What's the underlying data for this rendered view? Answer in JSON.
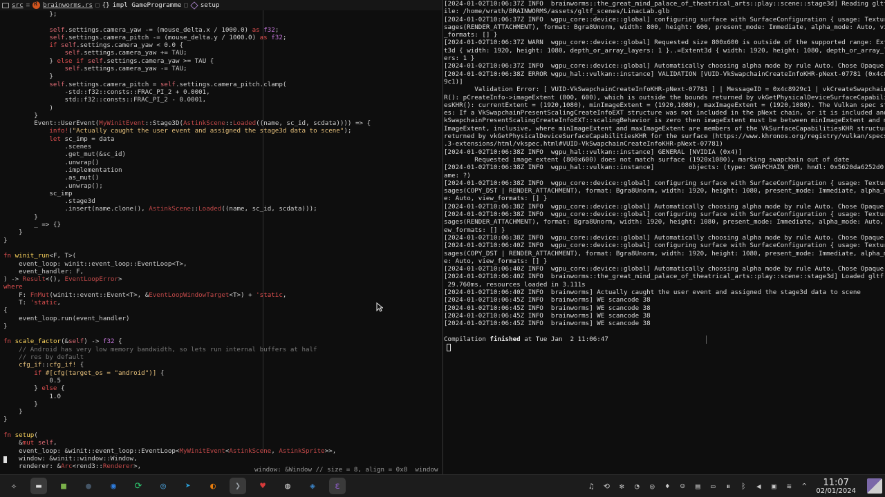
{
  "breadcrumb": {
    "folder": "src",
    "file": "brainworms.rs",
    "impl": "impl GameProgramme",
    "method": "setup"
  },
  "editor": {
    "hint": "window: &Window // size = 8, align = 0x8  window",
    "lines": [
      [
        [
          "            };",
          ""
        ]
      ],
      [
        [
          "",
          ""
        ]
      ],
      [
        [
          "            ",
          ""
        ],
        [
          "self",
          "self"
        ],
        [
          ".settings.camera_yaw -= (mouse_delta.x / 1000.0) ",
          ""
        ],
        [
          "as",
          "k"
        ],
        [
          " ",
          ""
        ],
        [
          "f32",
          "t"
        ],
        [
          ";",
          ""
        ]
      ],
      [
        [
          "            ",
          ""
        ],
        [
          "self",
          "self"
        ],
        [
          ".settings.camera_pitch -= (mouse_delta.y / 1000.0) ",
          ""
        ],
        [
          "as",
          "k"
        ],
        [
          " ",
          ""
        ],
        [
          "f32",
          "t"
        ],
        [
          ";",
          ""
        ]
      ],
      [
        [
          "            ",
          ""
        ],
        [
          "if",
          "k"
        ],
        [
          " ",
          ""
        ],
        [
          "self",
          "self"
        ],
        [
          ".settings.camera_yaw < 0.0 {",
          ""
        ]
      ],
      [
        [
          "                ",
          ""
        ],
        [
          "self",
          "self"
        ],
        [
          ".settings.camera_yaw += TAU;",
          ""
        ]
      ],
      [
        [
          "            } ",
          ""
        ],
        [
          "else if",
          "k"
        ],
        [
          " ",
          ""
        ],
        [
          "self",
          "self"
        ],
        [
          ".settings.camera_yaw >= TAU {",
          ""
        ]
      ],
      [
        [
          "                ",
          ""
        ],
        [
          "self",
          "self"
        ],
        [
          ".settings.camera_yaw -= TAU;",
          ""
        ]
      ],
      [
        [
          "            }",
          ""
        ]
      ],
      [
        [
          "            ",
          ""
        ],
        [
          "self",
          "self"
        ],
        [
          ".settings.camera_pitch = ",
          ""
        ],
        [
          "self",
          "self"
        ],
        [
          ".settings.camera_pitch.clamp(",
          ""
        ]
      ],
      [
        [
          "                -std::f32::consts::FRAC_PI_2 + 0.0001,",
          ""
        ]
      ],
      [
        [
          "                std::f32::consts::FRAC_PI_2 - 0.0001,",
          ""
        ]
      ],
      [
        [
          "            )",
          ""
        ]
      ],
      [
        [
          "        }",
          ""
        ]
      ],
      [
        [
          "        Event::UserEvent(",
          ""
        ],
        [
          "MyWinitEvent",
          "g"
        ],
        [
          "::Stage3D(",
          ""
        ],
        [
          "AstinkScene",
          "g"
        ],
        [
          "::",
          ""
        ],
        [
          "Loaded",
          "g"
        ],
        [
          "((name, sc_id, scdata)))) => {",
          ""
        ]
      ],
      [
        [
          "            ",
          ""
        ],
        [
          "info!",
          "k"
        ],
        [
          "(",
          ""
        ],
        [
          "\"Actually caught the user event and assigned the stage3d data to scene\"",
          "s"
        ],
        [
          ");",
          ""
        ]
      ],
      [
        [
          "            ",
          ""
        ],
        [
          "let",
          "k"
        ],
        [
          " sc_imp = data",
          ""
        ]
      ],
      [
        [
          "                .scenes",
          ""
        ]
      ],
      [
        [
          "                .get_mut(&sc_id)",
          ""
        ]
      ],
      [
        [
          "                .unwrap()",
          ""
        ]
      ],
      [
        [
          "                .implementation",
          ""
        ]
      ],
      [
        [
          "                .as_mut()",
          ""
        ]
      ],
      [
        [
          "                .unwrap();",
          ""
        ]
      ],
      [
        [
          "            sc_imp",
          ""
        ]
      ],
      [
        [
          "                .stage3d",
          ""
        ]
      ],
      [
        [
          "                .insert(name.clone(), ",
          ""
        ],
        [
          "AstinkScene",
          "g"
        ],
        [
          "::",
          ""
        ],
        [
          "Loaded",
          "g"
        ],
        [
          "((name, sc_id, scdata)));",
          ""
        ]
      ],
      [
        [
          "        }",
          ""
        ]
      ],
      [
        [
          "        _ => {}",
          ""
        ]
      ],
      [
        [
          "    }",
          ""
        ]
      ],
      [
        [
          "}",
          ""
        ]
      ],
      [
        [
          "",
          ""
        ]
      ],
      [
        [
          "fn",
          "k"
        ],
        [
          " ",
          ""
        ],
        [
          "winit_run",
          "y"
        ],
        [
          "<F, T>(",
          ""
        ]
      ],
      [
        [
          "    event_loop: winit::event_loop::EventLoop<T>,",
          ""
        ]
      ],
      [
        [
          "    event_handler: F,",
          ""
        ]
      ],
      [
        [
          ") -> ",
          ""
        ],
        [
          "Result",
          "g"
        ],
        [
          "<(), ",
          ""
        ],
        [
          "EventLoopError",
          "g"
        ],
        [
          ">",
          ""
        ]
      ],
      [
        [
          "where",
          "k"
        ]
      ],
      [
        [
          "    F: ",
          ""
        ],
        [
          "FnMut",
          "g"
        ],
        [
          "(winit::event::Event<T>, &",
          ""
        ],
        [
          "EventLoopWindowTarget",
          "g"
        ],
        [
          "<T>) + ",
          ""
        ],
        [
          "'static",
          "k"
        ],
        [
          ",",
          ""
        ]
      ],
      [
        [
          "    T: ",
          ""
        ],
        [
          "'static",
          "k"
        ],
        [
          ",",
          ""
        ]
      ],
      [
        [
          "{",
          ""
        ]
      ],
      [
        [
          "    event_loop.run(event_handler)",
          ""
        ]
      ],
      [
        [
          "}",
          ""
        ]
      ],
      [
        [
          "",
          ""
        ]
      ],
      [
        [
          "fn",
          "k"
        ],
        [
          " ",
          ""
        ],
        [
          "scale_factor",
          "y"
        ],
        [
          "(&",
          ""
        ],
        [
          "self",
          "self"
        ],
        [
          ") -> ",
          ""
        ],
        [
          "f32",
          "t"
        ],
        [
          " {",
          ""
        ]
      ],
      [
        [
          "    // Android has very low memory bandwidth, so lets run internal buffers at half",
          "c"
        ]
      ],
      [
        [
          "    // res by default",
          "c"
        ]
      ],
      [
        [
          "    ",
          ""
        ],
        [
          "cfg_if",
          "s"
        ],
        [
          "::",
          ""
        ],
        [
          "cfg_if!",
          "s"
        ],
        [
          " {",
          ""
        ]
      ],
      [
        [
          "        ",
          ""
        ],
        [
          "if",
          "k"
        ],
        [
          " ",
          ""
        ],
        [
          "#[cfg(target_os = \"android\")]",
          "s"
        ],
        [
          " {",
          ""
        ]
      ],
      [
        [
          "            0.5",
          ""
        ]
      ],
      [
        [
          "        } ",
          ""
        ],
        [
          "else",
          "k"
        ],
        [
          " {",
          ""
        ]
      ],
      [
        [
          "            1.0",
          ""
        ]
      ],
      [
        [
          "        }",
          ""
        ]
      ],
      [
        [
          "    }",
          ""
        ]
      ],
      [
        [
          "}",
          ""
        ]
      ],
      [
        [
          "",
          ""
        ]
      ],
      [
        [
          "fn",
          "k"
        ],
        [
          " ",
          ""
        ],
        [
          "setup",
          "y"
        ],
        [
          "(",
          ""
        ]
      ],
      [
        [
          "    &",
          ""
        ],
        [
          "mut",
          "k"
        ],
        [
          " ",
          ""
        ],
        [
          "self",
          "self"
        ],
        [
          ",",
          ""
        ]
      ],
      [
        [
          "    event_loop: &winit::event_loop::EventLoop<",
          ""
        ],
        [
          "MyWinitEvent",
          "g"
        ],
        [
          "<",
          ""
        ],
        [
          "AstinkScene",
          "g"
        ],
        [
          ", ",
          ""
        ],
        [
          "AstinkSprite",
          "g"
        ],
        [
          ">>,",
          ""
        ]
      ],
      [
        [
          "    window: &winit::window::Window,",
          ""
        ]
      ],
      [
        [
          "    renderer: &",
          ""
        ],
        [
          "Arc",
          "g"
        ],
        [
          "<rend3::",
          ""
        ],
        [
          "Renderer",
          "g"
        ],
        [
          ">,",
          ""
        ]
      ]
    ]
  },
  "terminal": {
    "lines": [
      [
        [
          "[2024-01-02T10:06:37Z INFO  brainworms::the_great_mind_palace_of_theatrical_arts::play::scene::stage3d] Reading gltf f",
          ""
        ]
      ],
      [
        [
          "ile: /home/wrath/BRAINWORMS/assets/gltf_scenes/LinacLab.glb",
          ""
        ]
      ],
      [
        [
          "[2024-01-02T10:06:37Z INFO  wgpu_core::device::global] configuring surface with SurfaceConfiguration { usage: TextureU",
          ""
        ]
      ],
      [
        [
          "sages(RENDER_ATTACHMENT), format: Bgra8Unorm, width: 800, height: 600, present_mode: Immediate, alpha_mode: Auto, view",
          ""
        ]
      ],
      [
        [
          "_formats: [] }",
          ""
        ]
      ],
      [
        [
          "[2024-01-02T10:06:37Z WARN  wgpu_core::device::global] Requested size 800x600 is outside of the supported range: Exten",
          ""
        ]
      ],
      [
        [
          "t3d { width: 1920, height: 1080, depth_or_array_layers: 1 }..=Extent3d { width: 1920, height: 1080, depth_or_array_lay",
          ""
        ]
      ],
      [
        [
          "ers: 1 }",
          ""
        ]
      ],
      [
        [
          "[2024-01-02T10:06:37Z INFO  wgpu_core::device::global] Automatically choosing alpha mode by rule Auto. Chose Opaque",
          ""
        ]
      ],
      [
        [
          "[2024-01-02T10:06:38Z ERROR wgpu_hal::vulkan::instance] VALIDATION [VUID-VkSwapchainCreateInfoKHR-pNext-07781 (0x4c892",
          ""
        ]
      ],
      [
        [
          "9c1)]",
          ""
        ]
      ],
      [
        [
          "        Validation Error: [ VUID-VkSwapchainCreateInfoKHR-pNext-07781 ] | MessageID = 0x4c8929c1 | vkCreateSwapchainKH",
          ""
        ]
      ],
      [
        [
          "R(): pCreateInfo->imageExtent (800, 600), which is outside the bounds returned by vkGetPhysicalDeviceSurfaceCapabili",
          ""
        ]
      ],
      [
        [
          "esKHR(): currentExtent = (1920,1080), minImageExtent = (1920,1080), maxImageExtent = (1920,1080). The Vulkan spec stat",
          ""
        ]
      ],
      [
        [
          "es: If a VkSwapchainPresentScalingCreateInfoEXT structure was not included in the pNext chain, or it is included and V",
          ""
        ]
      ],
      [
        [
          "kSwapchainPresentScalingCreateInfoEXT::scalingBehavior is zero then imageExtent must be between minImageExtent and max",
          ""
        ]
      ],
      [
        [
          "ImageExtent, inclusive, where minImageExtent and maxImageExtent are members of the VkSurfaceCapabilitiesKHR structure",
          ""
        ]
      ],
      [
        [
          "returned by vkGetPhysicalDeviceSurfaceCapabilitiesKHR for the surface (https://www.khronos.org/registry/vulkan/specs/1",
          ""
        ]
      ],
      [
        [
          ".3-extensions/html/vkspec.html#VUID-VkSwapchainCreateInfoKHR-pNext-07781)",
          ""
        ]
      ],
      [
        [
          "[2024-01-02T10:06:38Z INFO  wgpu_hal::vulkan::instance] GENERAL [NVIDIA (0x4)]",
          ""
        ]
      ],
      [
        [
          "        Requested image extent (800x600) does not match surface (1920x1080), marking swapchain out of date",
          ""
        ]
      ],
      [
        [
          "[2024-01-02T10:06:38Z INFO  wgpu_hal::vulkan::instance]         objects: (type: SWAPCHAIN_KHR, hndl: 0x5620da6252d0, n",
          ""
        ]
      ],
      [
        [
          "ame: ?)",
          ""
        ]
      ],
      [
        [
          "[2024-01-02T10:06:38Z INFO  wgpu_core::device::global] configuring surface with SurfaceConfiguration { usage: TextureU",
          ""
        ]
      ],
      [
        [
          "sages(COPY_DST | RENDER_ATTACHMENT), format: Bgra8Unorm, width: 1920, height: 1080, present_mode: Immediate, alpha_mod",
          ""
        ]
      ],
      [
        [
          "e: Auto, view_formats: [] }",
          ""
        ]
      ],
      [
        [
          "[2024-01-02T10:06:38Z INFO  wgpu_core::device::global] Automatically choosing alpha mode by rule Auto. Chose Opaque",
          ""
        ]
      ],
      [
        [
          "[2024-01-02T10:06:38Z INFO  wgpu_core::device::global] configuring surface with SurfaceConfiguration { usage: TextureU",
          ""
        ]
      ],
      [
        [
          "sages(RENDER_ATTACHMENT), format: Bgra8Unorm, width: 1920, height: 1080, present_mode: Immediate, alpha_mode: Auto, vi",
          ""
        ]
      ],
      [
        [
          "ew_formats: [] }",
          ""
        ]
      ],
      [
        [
          "[2024-01-02T10:06:38Z INFO  wgpu_core::device::global] Automatically choosing alpha mode by rule Auto. Chose Opaque",
          ""
        ]
      ],
      [
        [
          "[2024-01-02T10:06:40Z INFO  wgpu_core::device::global] configuring surface with SurfaceConfiguration { usage: TextureU",
          ""
        ]
      ],
      [
        [
          "sages(COPY_DST | RENDER_ATTACHMENT), format: Bgra8Unorm, width: 1920, height: 1080, present_mode: Immediate, alpha_mod",
          ""
        ]
      ],
      [
        [
          "e: Auto, view_formats: [] }",
          ""
        ]
      ],
      [
        [
          "[2024-01-02T10:06:40Z INFO  wgpu_core::device::global] Automatically choosing alpha mode by rule Auto. Chose Opaque",
          ""
        ]
      ],
      [
        [
          "[2024-01-02T10:06:40Z INFO  brainworms::the_great_mind_palace_of_theatrical_arts::play::scene::stage3d] Loaded gltf in",
          ""
        ]
      ],
      [
        [
          " 29.760ms, resources loaded in 3.111s",
          ""
        ]
      ],
      [
        [
          "[2024-01-02T10:06:40Z INFO  brainworms] Actually caught the user event and assigned the stage3d data to scene",
          ""
        ]
      ],
      [
        [
          "[2024-01-02T10:06:45Z INFO  brainworms] WE scancode 38",
          ""
        ]
      ],
      [
        [
          "[2024-01-02T10:06:45Z INFO  brainworms] WE scancode 38",
          ""
        ]
      ],
      [
        [
          "[2024-01-02T10:06:45Z INFO  brainworms] WE scancode 38",
          ""
        ]
      ],
      [
        [
          "[2024-01-02T10:06:45Z INFO  brainworms] WE scancode 38",
          ""
        ]
      ],
      [
        [
          "",
          ""
        ]
      ],
      [
        [
          "Compilation ",
          ""
        ],
        [
          "finished",
          "bold"
        ],
        [
          " at Tue Jan  2 11:06:47",
          ""
        ]
      ]
    ]
  },
  "taskbar": {
    "apps": [
      {
        "name": "app-launcher-icon",
        "glyph": "✧",
        "color": "#dddddd"
      },
      {
        "name": "task-manager-icon",
        "glyph": "▬",
        "color": "#dddddd",
        "active": true
      },
      {
        "name": "file-manager-icon",
        "glyph": "■",
        "color": "#7ab04a"
      },
      {
        "name": "dark-circle-app-icon",
        "glyph": "●",
        "color": "#445566"
      },
      {
        "name": "firefox-icon",
        "glyph": "◉",
        "color": "#2f7ee0"
      },
      {
        "name": "sync-app-icon",
        "glyph": "⟳",
        "color": "#2ecc71"
      },
      {
        "name": "steam-icon",
        "glyph": "◎",
        "color": "#4a9fd8"
      },
      {
        "name": "telegram-icon",
        "glyph": "➤",
        "color": "#2ca5e0"
      },
      {
        "name": "blender-icon",
        "glyph": "◐",
        "color": "#e87d0d"
      },
      {
        "name": "terminal-icon",
        "glyph": "❯",
        "color": "#9aa0a6",
        "active": true
      },
      {
        "name": "strawberry-icon",
        "glyph": "♥",
        "color": "#d63a3a"
      },
      {
        "name": "obs-icon",
        "glyph": "◍",
        "color": "#cccccc"
      },
      {
        "name": "discover-icon",
        "glyph": "◈",
        "color": "#3b82c4"
      },
      {
        "name": "emacs-icon",
        "glyph": "ε",
        "color": "#8b5cc4",
        "active": true
      }
    ],
    "tray": [
      {
        "name": "notification-bell-icon",
        "glyph": "♫"
      },
      {
        "name": "sync-tray-icon",
        "glyph": "⟲"
      },
      {
        "name": "gear-tray-icon",
        "glyph": "✻"
      },
      {
        "name": "network-tray-icon",
        "glyph": "◔"
      },
      {
        "name": "steam-tray-icon",
        "glyph": "◎"
      },
      {
        "name": "game-tray-icon",
        "glyph": "♦"
      },
      {
        "name": "discord-tray-icon",
        "glyph": "☺"
      },
      {
        "name": "clipboard-icon",
        "glyph": "▤"
      },
      {
        "name": "printer-icon",
        "glyph": "▭"
      },
      {
        "name": "media-pause-icon",
        "glyph": "⏸"
      },
      {
        "name": "bluetooth-icon",
        "glyph": "ᛒ"
      },
      {
        "name": "volume-icon",
        "glyph": "◀"
      },
      {
        "name": "display-icon",
        "glyph": "▣"
      },
      {
        "name": "wifi-icon",
        "glyph": "≋"
      },
      {
        "name": "expand-tray-icon",
        "glyph": "^"
      }
    ],
    "clock": {
      "time": "11:07",
      "date": "02/01/2024"
    }
  }
}
